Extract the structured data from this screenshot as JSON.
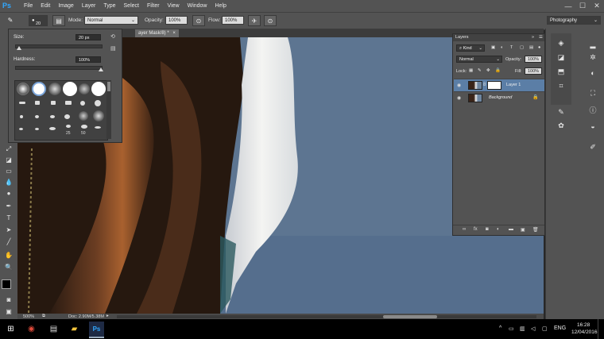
{
  "app": {
    "logo": "Ps"
  },
  "menu": {
    "items": [
      "File",
      "Edit",
      "Image",
      "Layer",
      "Type",
      "Select",
      "Filter",
      "View",
      "Window",
      "Help"
    ]
  },
  "window_controls": {
    "minimize": "—",
    "maximize": "☐",
    "close": "✕"
  },
  "options": {
    "brush_size": "20",
    "mode_label": "Mode:",
    "mode_value": "Normal",
    "opacity_label": "Opacity:",
    "opacity_value": "100%",
    "flow_label": "Flow:",
    "flow_value": "100%",
    "workspace": "Photography"
  },
  "document": {
    "tab_title": "ayer Mask/8) *",
    "zoom": "500%",
    "doc_size": "Doc: 2.90M/5.38M"
  },
  "brush_picker": {
    "size_label": "Size:",
    "size_value": "20 px",
    "hardness_label": "Hardness:",
    "hardness_value": "100%",
    "size_level": 0.05,
    "hardness_level": 1.0,
    "tip_numbers": [
      "25",
      "50"
    ]
  },
  "layers_panel": {
    "tab_title": "Layers",
    "filter_label": "Kind",
    "blend_mode": "Normal",
    "opacity_label": "Opacity:",
    "opacity_value": "100%",
    "lock_label": "Lock:",
    "fill_label": "Fill:",
    "fill_value": "100%",
    "layers": [
      {
        "name": "Layer 1",
        "selected": true,
        "has_mask": true
      },
      {
        "name": "Background",
        "selected": false,
        "locked": true
      }
    ]
  },
  "taskbar": {
    "language": "ENG",
    "time": "16:28",
    "date": "12/04/2016"
  },
  "colors": {
    "accent": "#31a8ff",
    "panel": "#535353",
    "selected_layer": "#5b7ea6"
  }
}
